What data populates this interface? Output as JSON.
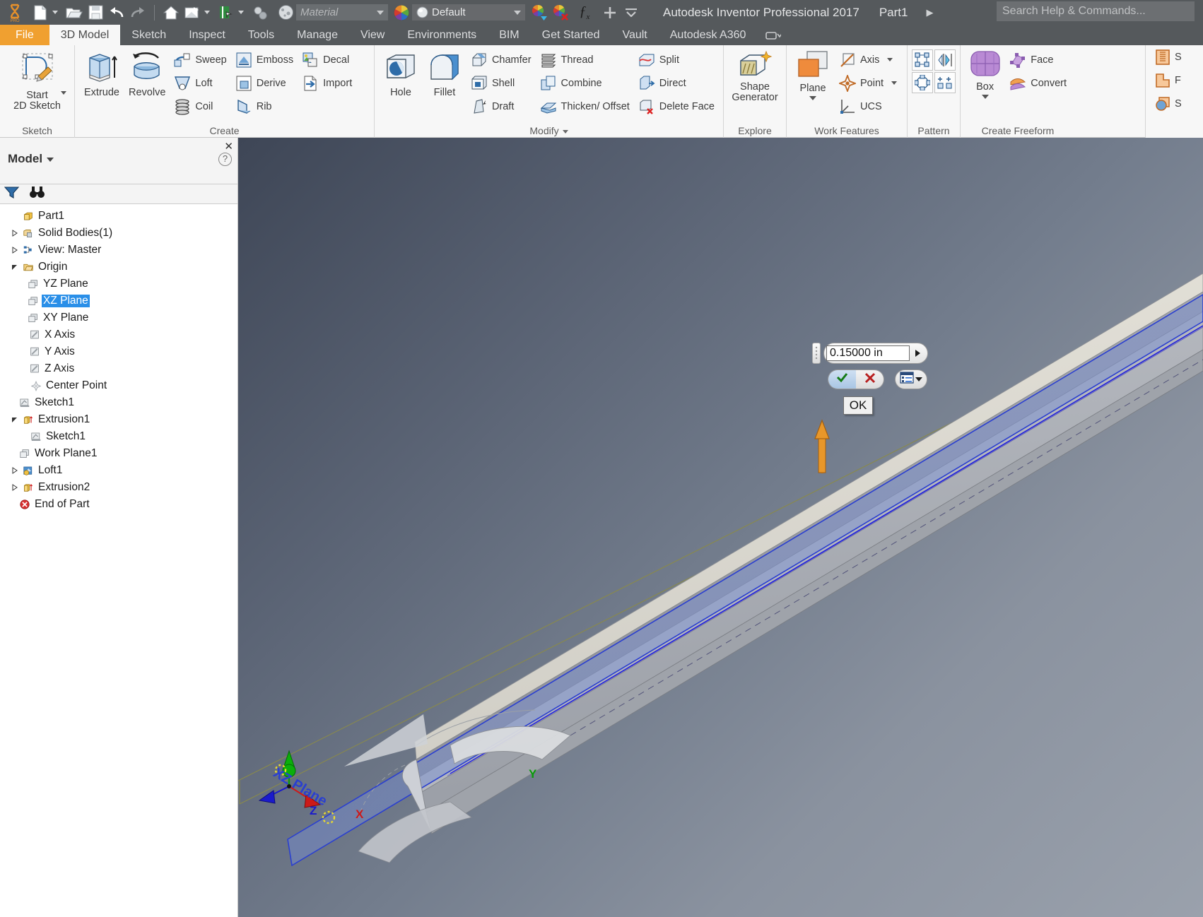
{
  "titlebar": {
    "app_title": "Autodesk Inventor Professional 2017",
    "document_name": "Part1",
    "arrow": "▶",
    "search_placeholder": "Search Help & Commands...",
    "material_placeholder": "Material",
    "appearance_value": "Default",
    "fx_label": "ƒx",
    "icons": [
      "inventor-logo-icon",
      "new-file-icon",
      "open-file-icon",
      "save-icon",
      "undo-icon",
      "redo-icon",
      "home-icon",
      "return-icon",
      "update-icon",
      "select-icon",
      "material-sphere-icon",
      "appearance-wheel-icon",
      "adjust-appearance-icon",
      "clear-appearance-icon",
      "fx-icon",
      "plus-icon",
      "customize-icon"
    ]
  },
  "tabs": [
    {
      "label": "File",
      "kind": "file"
    },
    {
      "label": "3D Model",
      "kind": "active"
    },
    {
      "label": "Sketch",
      "kind": "normal"
    },
    {
      "label": "Inspect",
      "kind": "normal"
    },
    {
      "label": "Tools",
      "kind": "normal"
    },
    {
      "label": "Manage",
      "kind": "normal"
    },
    {
      "label": "View",
      "kind": "normal"
    },
    {
      "label": "Environments",
      "kind": "normal"
    },
    {
      "label": "BIM",
      "kind": "normal"
    },
    {
      "label": "Get Started",
      "kind": "normal"
    },
    {
      "label": "Vault",
      "kind": "normal"
    },
    {
      "label": "Autodesk A360",
      "kind": "normal"
    }
  ],
  "ribbon": {
    "panels": [
      {
        "title": "Sketch",
        "big": [
          {
            "label": "Start\n2D Sketch",
            "icon": "start-2d-sketch-icon",
            "dropdown": true
          }
        ],
        "small": []
      },
      {
        "title": "Create",
        "dropdown": false,
        "big": [
          {
            "label": "Extrude",
            "icon": "extrude-icon"
          },
          {
            "label": "Revolve",
            "icon": "revolve-icon"
          }
        ],
        "columns": [
          [
            {
              "label": "Sweep",
              "icon": "sweep-icon"
            },
            {
              "label": "Loft",
              "icon": "loft-icon"
            },
            {
              "label": "Coil",
              "icon": "coil-icon"
            }
          ],
          [
            {
              "label": "Emboss",
              "icon": "emboss-icon"
            },
            {
              "label": "Derive",
              "icon": "derive-icon"
            },
            {
              "label": "Rib",
              "icon": "rib-icon"
            }
          ],
          [
            {
              "label": "Decal",
              "icon": "decal-icon"
            },
            {
              "label": "Import",
              "icon": "import-icon"
            }
          ]
        ]
      },
      {
        "title": "Modify",
        "dropdown": true,
        "big": [
          {
            "label": "Hole",
            "icon": "hole-icon"
          },
          {
            "label": "Fillet",
            "icon": "fillet-icon"
          }
        ],
        "columns": [
          [
            {
              "label": "Chamfer",
              "icon": "chamfer-icon"
            },
            {
              "label": "Shell",
              "icon": "shell-icon"
            },
            {
              "label": "Draft",
              "icon": "draft-icon"
            }
          ],
          [
            {
              "label": "Thread",
              "icon": "thread-icon"
            },
            {
              "label": "Combine",
              "icon": "combine-icon"
            },
            {
              "label": "Thicken/ Offset",
              "icon": "thicken-offset-icon"
            }
          ],
          [
            {
              "label": "Split",
              "icon": "split-icon"
            },
            {
              "label": "Direct",
              "icon": "direct-icon"
            },
            {
              "label": "Delete Face",
              "icon": "delete-face-icon"
            }
          ]
        ]
      },
      {
        "title": "Explore",
        "big": [
          {
            "label": "Shape\nGenerator",
            "icon": "shape-generator-icon"
          }
        ],
        "columns": []
      },
      {
        "title": "Work Features",
        "big": [
          {
            "label": "Plane",
            "icon": "plane-icon",
            "dropdown": true
          }
        ],
        "columns": [
          [
            {
              "label": "Axis",
              "icon": "axis-icon",
              "dropdown": true
            },
            {
              "label": "Point",
              "icon": "point-icon",
              "dropdown": true
            },
            {
              "label": "UCS",
              "icon": "ucs-icon"
            }
          ]
        ]
      },
      {
        "title": "Pattern",
        "grid": [
          "rectangular-pattern-icon",
          "mirror-icon",
          "circular-pattern-icon",
          "sketch-driven-pattern-icon"
        ]
      },
      {
        "title": "Create Freeform",
        "big": [
          {
            "label": "Box",
            "icon": "freeform-box-icon",
            "dropdown": true
          }
        ],
        "columns": [
          [
            {
              "label": "Face",
              "icon": "freeform-face-icon"
            },
            {
              "label": "Convert",
              "icon": "freeform-convert-icon"
            }
          ]
        ]
      }
    ],
    "right_partial": {
      "labels": [
        "S",
        "F",
        "S"
      ],
      "icons": [
        "coil-surface-icon",
        "plane-surface-icon",
        "sphere-surface-icon"
      ]
    }
  },
  "browser": {
    "panel_title": "Model",
    "close_icon": "✕",
    "help_icon": "?",
    "filter_icon": "filter-icon",
    "find_icon": "binoculars-icon",
    "tree": [
      {
        "label": "Part1",
        "icon": "part-icon",
        "indent": 0,
        "expander": "none",
        "selected": false
      },
      {
        "label": "Solid Bodies(1)",
        "icon": "solid-bodies-icon",
        "indent": 1,
        "expander": "collapsed",
        "selected": false
      },
      {
        "label": "View: Master",
        "icon": "view-master-icon",
        "indent": 1,
        "expander": "collapsed",
        "selected": false
      },
      {
        "label": "Origin",
        "icon": "folder-icon",
        "indent": 1,
        "expander": "expanded",
        "selected": false
      },
      {
        "label": "YZ Plane",
        "icon": "plane-node-icon",
        "indent": 2,
        "expander": "none",
        "selected": false
      },
      {
        "label": "XZ Plane",
        "icon": "plane-node-icon",
        "indent": 2,
        "expander": "none",
        "selected": true
      },
      {
        "label": "XY Plane",
        "icon": "plane-node-icon",
        "indent": 2,
        "expander": "none",
        "selected": false
      },
      {
        "label": "X Axis",
        "icon": "axis-node-icon",
        "indent": 2,
        "expander": "none",
        "selected": false
      },
      {
        "label": "Y Axis",
        "icon": "axis-node-icon",
        "indent": 2,
        "expander": "none",
        "selected": false
      },
      {
        "label": "Z Axis",
        "icon": "axis-node-icon",
        "indent": 2,
        "expander": "none",
        "selected": false
      },
      {
        "label": "Center Point",
        "icon": "center-point-icon",
        "indent": 2,
        "expander": "none",
        "selected": false
      },
      {
        "label": "Sketch1",
        "icon": "sketch-icon",
        "indent": 1,
        "expander": "none",
        "selected": false
      },
      {
        "label": "Extrusion1",
        "icon": "extrusion-icon",
        "indent": 1,
        "expander": "expanded",
        "selected": false
      },
      {
        "label": "Sketch1",
        "icon": "sketch-icon",
        "indent": 2,
        "expander": "none",
        "selected": false
      },
      {
        "label": "Work Plane1",
        "icon": "plane-node-icon",
        "indent": 1,
        "expander": "none",
        "selected": false
      },
      {
        "label": "Loft1",
        "icon": "loft-node-icon",
        "indent": 1,
        "expander": "collapsed",
        "selected": false
      },
      {
        "label": "Extrusion2",
        "icon": "extrusion-icon",
        "indent": 1,
        "expander": "collapsed",
        "selected": false
      },
      {
        "label": "End of Part",
        "icon": "end-of-part-icon",
        "indent": 1,
        "expander": "none",
        "selected": false
      }
    ]
  },
  "viewport": {
    "plane_label": "XZ Plane",
    "axis_labels": {
      "x": "X",
      "y": "Y",
      "z": "Z"
    },
    "hud": {
      "value": "0.15000 in",
      "accept_icon": "checkmark-icon",
      "cancel_icon": "x-mark-icon",
      "options_icon": "options-list-icon",
      "spinner_icon": "spinner-arrow-icon",
      "grip_icon": "drag-grip-icon",
      "ok_label": "OK"
    }
  },
  "colors": {
    "accent_orange": "#f0a030",
    "selection_blue": "#2a8fe8",
    "ribbon_bg": "#f7f7f7",
    "titlebar_bg": "#55595c",
    "viewport_top": "#3e4656",
    "viewport_bottom": "#9aa1ac"
  }
}
